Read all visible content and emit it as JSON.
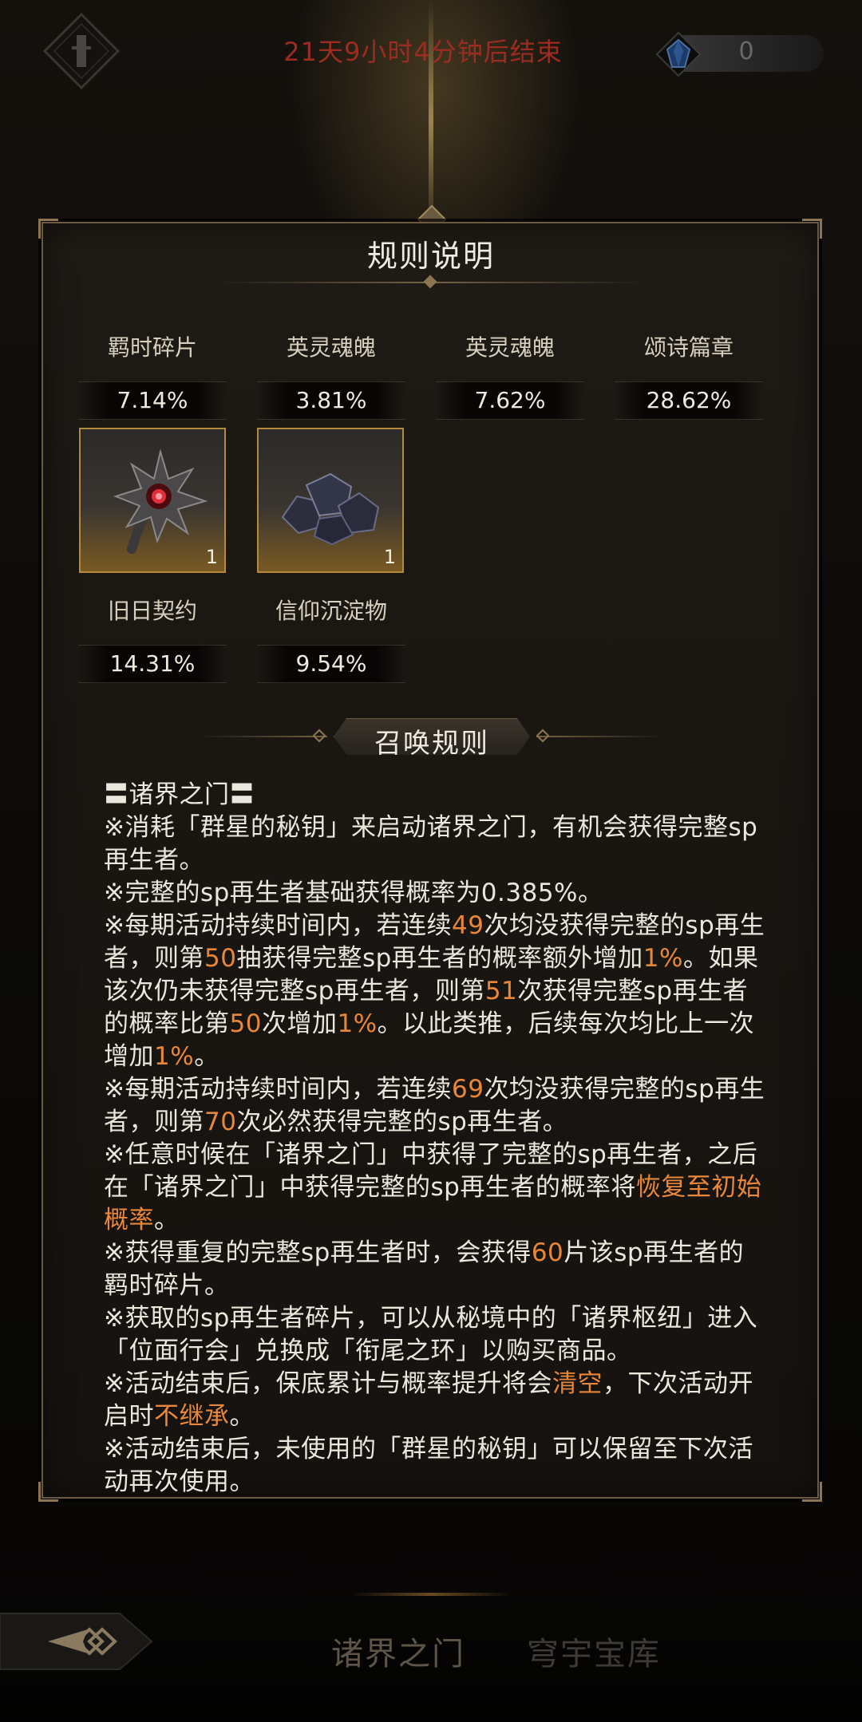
{
  "header": {
    "timer_text": "21天9小时4分钟后结束",
    "currency_value": "0",
    "emblem_icon": "shrine-emblem-icon",
    "currency_icon": "blue-crystal-icon"
  },
  "panel": {
    "title": "规则说明",
    "items": [
      {
        "name": "羁时碎片",
        "rate": "7.14%"
      },
      {
        "name": "英灵魂魄",
        "rate": "3.81%"
      },
      {
        "name": "英灵魂魄",
        "rate": "7.62%"
      },
      {
        "name": "颂诗篇章",
        "rate": "28.62%"
      },
      {
        "name": "旧日契约",
        "rate": "14.31%",
        "count": "1",
        "icon": "spiked-relic-icon"
      },
      {
        "name": "信仰沉淀物",
        "rate": "9.54%",
        "count": "1",
        "icon": "dark-ore-icon"
      }
    ],
    "section_title": "召唤规则",
    "rules_heading": "〓诸界之门〓",
    "rules": [
      [
        {
          "t": "※消耗「群星的秘钥」来启动诸界之门，有机会获得完整sp再生者。"
        }
      ],
      [
        {
          "t": "※完整的sp再生者基础获得概率为0.385%。"
        }
      ],
      [
        {
          "t": "※每期活动持续时间内，若连续"
        },
        {
          "t": "49",
          "h": true
        },
        {
          "t": "次均没获得完整的sp再生者，则第"
        },
        {
          "t": "50",
          "h": true
        },
        {
          "t": "抽获得完整sp再生者的概率额外增加"
        },
        {
          "t": "1%",
          "h": true
        },
        {
          "t": "。如果该次仍未获得完整sp再生者，则第"
        },
        {
          "t": "51",
          "h": true
        },
        {
          "t": "次获得完整sp再生者的概率比第"
        },
        {
          "t": "50",
          "h": true
        },
        {
          "t": "次增加"
        },
        {
          "t": "1%",
          "h": true
        },
        {
          "t": "。以此类推，后续每次均比上一次增加"
        },
        {
          "t": "1%",
          "h": true
        },
        {
          "t": "。"
        }
      ],
      [
        {
          "t": "※每期活动持续时间内，若连续"
        },
        {
          "t": "69",
          "h": true
        },
        {
          "t": "次均没获得完整的sp再生者，则第"
        },
        {
          "t": "70",
          "h": true
        },
        {
          "t": "次必然获得完整的sp再生者。"
        }
      ],
      [
        {
          "t": "※任意时候在「诸界之门」中获得了完整的sp再生者，之后在「诸界之门」中获得完整的sp再生者的概率将"
        },
        {
          "t": "恢复至初始概率",
          "h": true
        },
        {
          "t": "。"
        }
      ],
      [
        {
          "t": "※获得重复的完整sp再生者时，会获得"
        },
        {
          "t": "60",
          "h": true
        },
        {
          "t": "片该sp再生者的羁时碎片。"
        }
      ],
      [
        {
          "t": "※获取的sp再生者碎片，可以从秘境中的「诸界枢纽」进入「位面行会」兑换成「衔尾之环」以购买商品。"
        }
      ],
      [
        {
          "t": "※活动结束后，保底累计与概率提升将会"
        },
        {
          "t": "清空",
          "h": true
        },
        {
          "t": "，下次活动开启时"
        },
        {
          "t": "不继承",
          "h": true
        },
        {
          "t": "。"
        }
      ],
      [
        {
          "t": "※活动结束后，未使用的「群星的秘钥」可以保留至下次活动再次使用。"
        }
      ]
    ]
  },
  "footer": {
    "back_icon": "back-arrow-icon",
    "tabs": [
      "诸界之门",
      "穹宇宝库"
    ]
  },
  "colors": {
    "timer": "#9b2c22",
    "highlight": "#e8873a",
    "border_gold": "#b48a3c"
  }
}
